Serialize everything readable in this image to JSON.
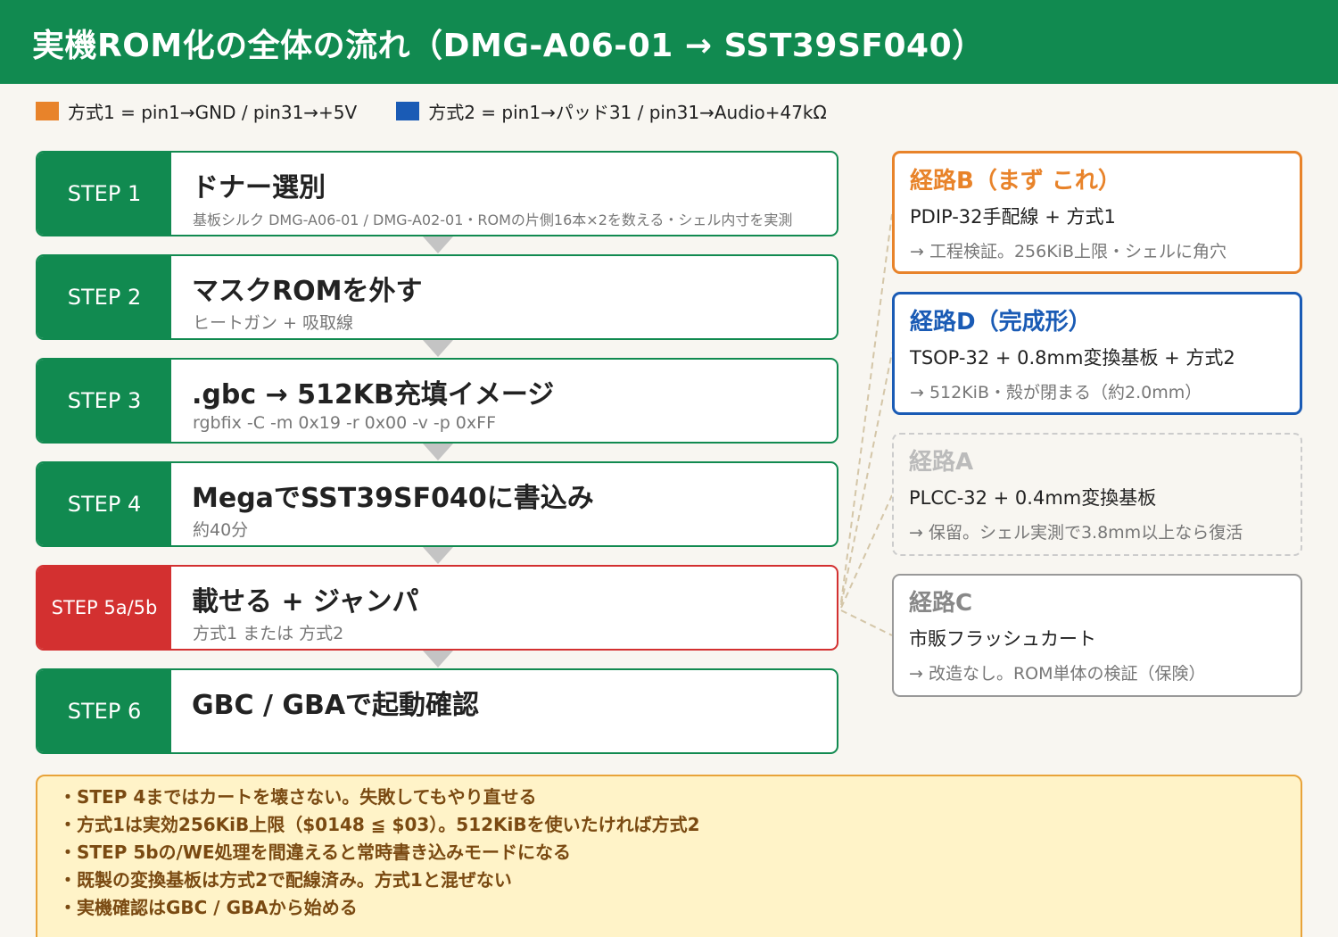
{
  "header": {
    "title": "実機ROM化の全体の流れ（DMG-A06-01 → SST39SF040）"
  },
  "legend": {
    "items": [
      {
        "label": "方式1 = pin1→GND / pin31→+5V",
        "color": "#e8832a"
      },
      {
        "label": "方式2 = pin1→パッド31 / pin31→Audio+47kΩ",
        "color": "#1a5bb5"
      }
    ]
  },
  "steps": [
    {
      "tag": "STEP 1",
      "title": "ドナー選別",
      "sub": "基板シルク DMG-A06-01 / DMG-A02-01・ROMの片側16本×2を数える・シェル内寸を実測"
    },
    {
      "tag": "STEP 2",
      "title": "マスクROMを外す",
      "sub": "ヒートガン + 吸取線"
    },
    {
      "tag": "STEP 3",
      "title": ".gbc → 512KB充填イメージ",
      "sub": "rgbfix -C -m 0x19 -r 0x00 -v -p 0xFF"
    },
    {
      "tag": "STEP 4",
      "title": "MegaでSST39SF040に書込み",
      "sub": "約40分"
    },
    {
      "tag": "STEP 5a/5b",
      "title": "載せる + ジャンパ",
      "sub": "方式1 または 方式2"
    },
    {
      "tag": "STEP 6",
      "title": "GBC / GBAで起動確認",
      "sub": ""
    }
  ],
  "routes": [
    {
      "name": "経路B（まず これ）",
      "desc": "PDIP-32手配線 + 方式1",
      "note": "→ 工程検証。256KiB上限・シェルに角穴"
    },
    {
      "name": "経路D（完成形）",
      "desc": "TSOP-32 + 0.8mm変換基板 + 方式2",
      "note": "→ 512KiB・殻が閉まる（約2.0mm）"
    },
    {
      "name": "経路A",
      "desc": "PLCC-32 + 0.4mm変換基板",
      "note": "→ 保留。シェル実測で3.8mm以上なら復活"
    },
    {
      "name": "経路C",
      "desc": "市販フラッシュカート",
      "note": "→ 改造なし。ROM単体の検証（保険）"
    }
  ],
  "notes": [
    "・STEP 4まではカートを壊さない。失敗してもやり直せる",
    "・方式1は実効256KiB上限（$0148 ≦ $03）。512KiBを使いたければ方式2",
    "・STEP 5bの/WE処理を間違えると常時書き込みモードになる",
    "・既製の変換基板は方式2で配線済み。方式1と混ぜない",
    "・実機確認はGBC / GBAから始める"
  ],
  "colors": {
    "green": "#118a50",
    "red": "#d33030",
    "orange": "#e8832a",
    "blue": "#1a5bb5",
    "note_bg": "#fff3c8"
  }
}
